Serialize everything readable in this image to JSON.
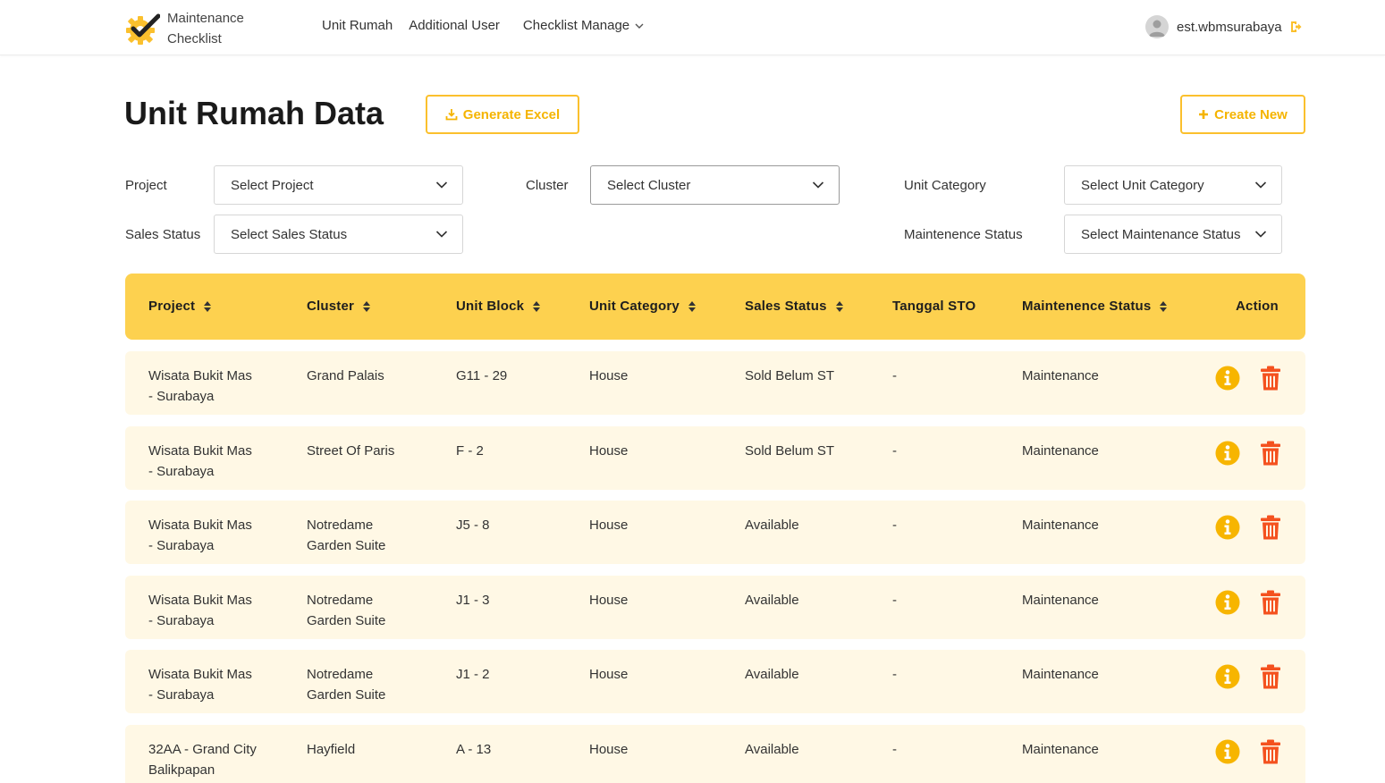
{
  "nav": {
    "brand_line1": "Maintenance",
    "brand_line2": "Checklist",
    "links": [
      "Unit Rumah",
      "Additional User",
      "Checklist Manage"
    ],
    "user_name": "est.wbmsurabaya"
  },
  "header": {
    "title": "Unit Rumah Data",
    "generate_excel": "Generate Excel",
    "create_new": "Create New"
  },
  "filters": {
    "project_label": "Project",
    "project_value": "Select Project",
    "cluster_label": "Cluster",
    "cluster_value": "Select Cluster",
    "unit_category_label": "Unit Category",
    "unit_category_value": "Select Unit Category",
    "sales_status_label": "Sales Status",
    "sales_status_value": "Select Sales Status",
    "maintenance_status_label": "Maintenence Status",
    "maintenance_status_value": "Select Maintenance Status"
  },
  "table": {
    "headers": [
      "Project",
      "Cluster",
      "Unit Block",
      "Unit Category",
      "Sales Status",
      "Tanggal STO",
      "Maintenence Status",
      "Action"
    ],
    "rows": [
      {
        "project1": "Wisata Bukit Mas",
        "project2": "- Surabaya",
        "cluster1": "Grand Palais",
        "cluster2": "",
        "block": "G11 - 29",
        "category": "House",
        "sales": "Sold Belum ST",
        "sto": "-",
        "maint": "Maintenance"
      },
      {
        "project1": "Wisata Bukit Mas",
        "project2": "- Surabaya",
        "cluster1": "Street Of Paris",
        "cluster2": "",
        "block": "F - 2",
        "category": "House",
        "sales": "Sold Belum ST",
        "sto": "-",
        "maint": "Maintenance"
      },
      {
        "project1": "Wisata Bukit Mas",
        "project2": "- Surabaya",
        "cluster1": "Notredame",
        "cluster2": "Garden Suite",
        "block": "J5 - 8",
        "category": "House",
        "sales": "Available",
        "sto": "-",
        "maint": "Maintenance"
      },
      {
        "project1": "Wisata Bukit Mas",
        "project2": "- Surabaya",
        "cluster1": "Notredame",
        "cluster2": "Garden Suite",
        "block": "J1 - 3",
        "category": "House",
        "sales": "Available",
        "sto": "-",
        "maint": "Maintenance"
      },
      {
        "project1": "Wisata Bukit Mas",
        "project2": "- Surabaya",
        "cluster1": "Notredame",
        "cluster2": "Garden Suite",
        "block": "J1 - 2",
        "category": "House",
        "sales": "Available",
        "sto": "-",
        "maint": "Maintenance"
      },
      {
        "project1": "32AA - Grand City",
        "project2": "Balikpapan",
        "cluster1": "Hayfield",
        "cluster2": "",
        "block": "A - 13",
        "category": "House",
        "sales": "Available",
        "sto": "-",
        "maint": "Maintenance"
      }
    ]
  },
  "colors": {
    "accent": "#fdd14f",
    "button_border": "#fbc02d",
    "row_bg": "#fff8e5",
    "info_icon": "#f7b500",
    "delete_icon": "#f4511e"
  }
}
